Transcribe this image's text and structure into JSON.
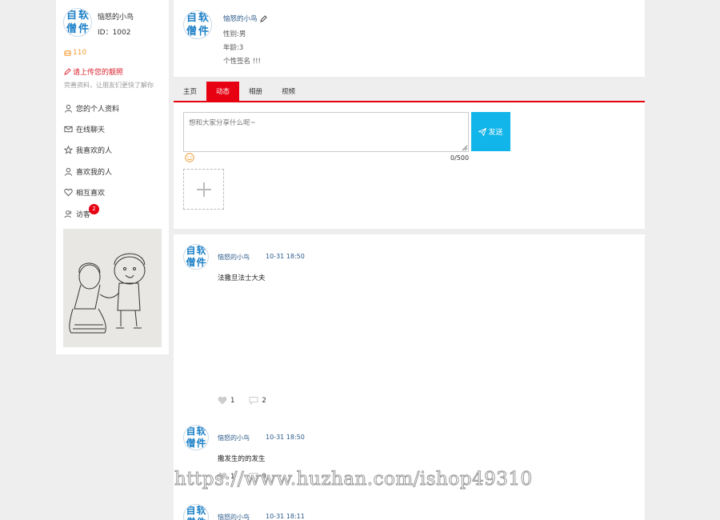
{
  "sidebar": {
    "logo_chars": [
      "自",
      "软",
      "僧",
      "件"
    ],
    "username": "恼怒的小鸟",
    "user_id": "ID：1002",
    "coins": "110",
    "upload_prompt": "请上传您的靓照",
    "hint": "完善资料，让朋友们更快了解你",
    "menu": [
      {
        "icon": "user-icon",
        "label": "您的个人资料"
      },
      {
        "icon": "mail-icon",
        "label": "在线聊天"
      },
      {
        "icon": "star-icon",
        "label": "我喜欢的人"
      },
      {
        "icon": "user-icon",
        "label": "喜欢我的人"
      },
      {
        "icon": "heart-icon",
        "label": "相互喜欢"
      },
      {
        "icon": "users-icon",
        "label": "访客",
        "badge": "2"
      }
    ]
  },
  "profile": {
    "name": "恼怒的小鸟",
    "gender": "性别:男",
    "age": "年龄:3",
    "signature": "个性签名 !!!"
  },
  "tabs": [
    "主页",
    "动态",
    "相册",
    "视频"
  ],
  "active_tab": "动态",
  "composer": {
    "placeholder": "想和大家分享什么呢~",
    "send_label": "发送",
    "counter": "0/500"
  },
  "posts": [
    {
      "author": "恼怒的小鸟",
      "time": "10-31 18:50",
      "text": "法撒旦法士大夫",
      "likes": "1",
      "comments": "2"
    },
    {
      "author": "恼怒的小鸟",
      "time": "10-31 18:50",
      "text": "撒发生的的发生",
      "likes": "1",
      "comments": "0"
    },
    {
      "author": "恼怒的小鸟",
      "time": "10-31 18:11",
      "text": "",
      "likes": "",
      "comments": ""
    }
  ],
  "watermark": "https://www.huzhan.com/ishop49310",
  "colors": {
    "accent": "#e60012",
    "send": "#12b5e9",
    "link": "#2a5a8a",
    "coins": "#f39b34"
  }
}
